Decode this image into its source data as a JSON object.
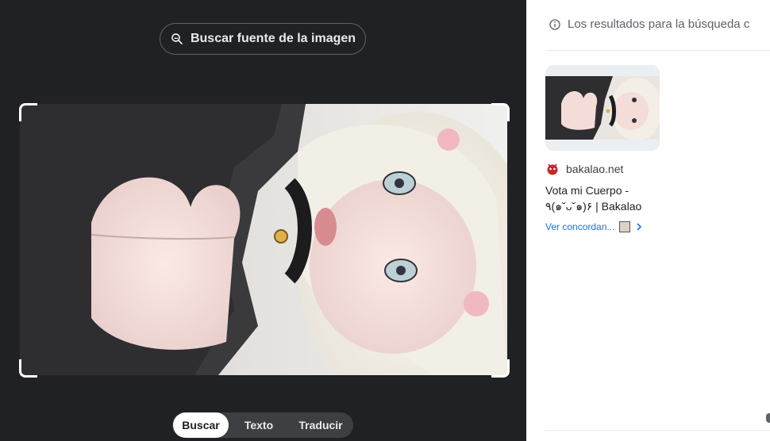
{
  "lens": {
    "find_source_label": "Buscar fuente de la imagen",
    "tabs": [
      {
        "label": "Buscar",
        "active": true
      },
      {
        "label": "Texto",
        "active": false
      },
      {
        "label": "Traducir",
        "active": false
      }
    ]
  },
  "results": {
    "notice": "Los resultados para la búsqueda c",
    "items": [
      {
        "source": "bakalao.net",
        "title": "Vota mi Cuerpo - ٩(๑˘ᴗ˘๑)۶ | Bakalao",
        "matches_label": "Ver concordan..."
      }
    ]
  },
  "colors": {
    "dark_bg": "#202124",
    "accent_link": "#1a73e8"
  },
  "icons": {
    "find_source": "image-search-icon",
    "notice": "info-icon",
    "matches_arrow": "chevron-right-icon"
  }
}
